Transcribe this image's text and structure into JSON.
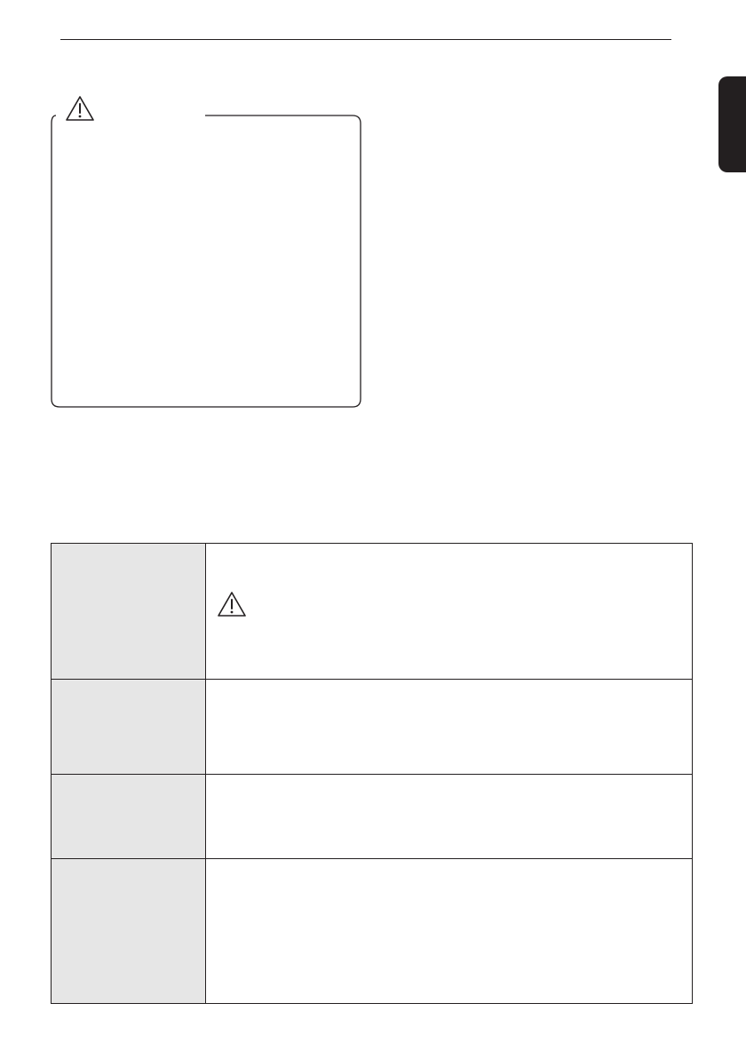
{
  "header": {
    "rule": true
  },
  "side_tab": {
    "color": "#231f20",
    "label": ""
  },
  "caution_box": {
    "icon": "warning-triangle-icon",
    "border_color": "#231f20"
  },
  "spec_table": {
    "label_background": "#e6e6e6",
    "rows": [
      {
        "label": "",
        "content": "",
        "icon": "warning-triangle-icon"
      },
      {
        "label": "",
        "content": ""
      },
      {
        "label": "",
        "content": ""
      },
      {
        "label": "",
        "content": ""
      }
    ]
  }
}
